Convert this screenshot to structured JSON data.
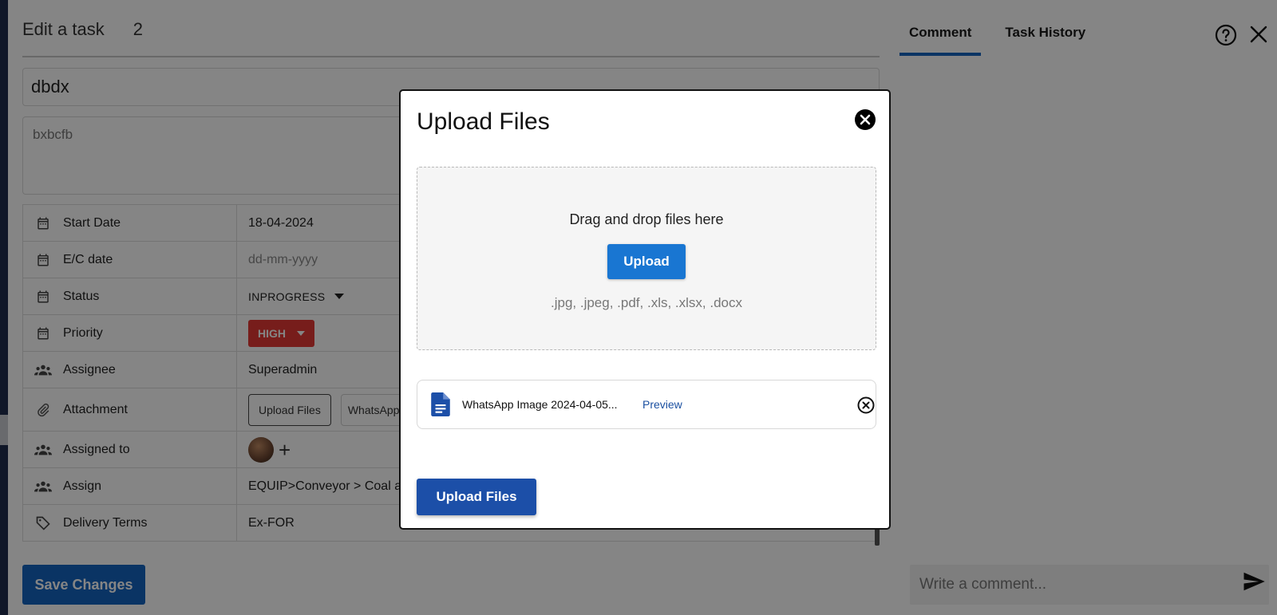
{
  "task": {
    "header_title": "Edit a task",
    "task_number": "2",
    "title_value": "dbdx",
    "description_value": "bxbcfb",
    "save_label": "Save Changes"
  },
  "properties": [
    {
      "label": "Start Date",
      "value": "18-04-2024",
      "icon": "calendar-icon"
    },
    {
      "label": "E/C date",
      "value": "dd-mm-yyyy",
      "icon": "calendar-icon"
    },
    {
      "label": "Status",
      "value": "INPROGRESS",
      "icon": "calendar-icon"
    },
    {
      "label": "Priority",
      "value": "HIGH",
      "icon": "calendar-icon"
    },
    {
      "label": "Assignee",
      "value": "Superadmin",
      "icon": "people-icon"
    },
    {
      "label": "Attachment",
      "button": "Upload Files",
      "chip": "WhatsApp",
      "icon": "paperclip-icon"
    },
    {
      "label": "Assigned to",
      "value": "+",
      "icon": "people-icon"
    },
    {
      "label": "Assign",
      "value": "EQUIP>Conveyor > Coal and",
      "icon": "people-icon"
    },
    {
      "label": "Delivery Terms",
      "value": "Ex-FOR",
      "icon": "tag-icon"
    }
  ],
  "side_panel": {
    "tabs": [
      "Comment",
      "Task History"
    ],
    "comment_placeholder": "Write a comment..."
  },
  "modal": {
    "title": "Upload Files",
    "drop_text": "Drag and drop files here",
    "upload_label": "Upload",
    "allowed_types": ".jpg, .jpeg, .pdf, .xls, .xlsx, .docx",
    "file_name": "WhatsApp Image 2024-04-05...",
    "preview_label": "Preview",
    "submit_label": "Upload Files"
  },
  "colors": {
    "primary": "#1565c0",
    "priority_high": "#e53935",
    "sidebar": "#1f2d4d"
  }
}
